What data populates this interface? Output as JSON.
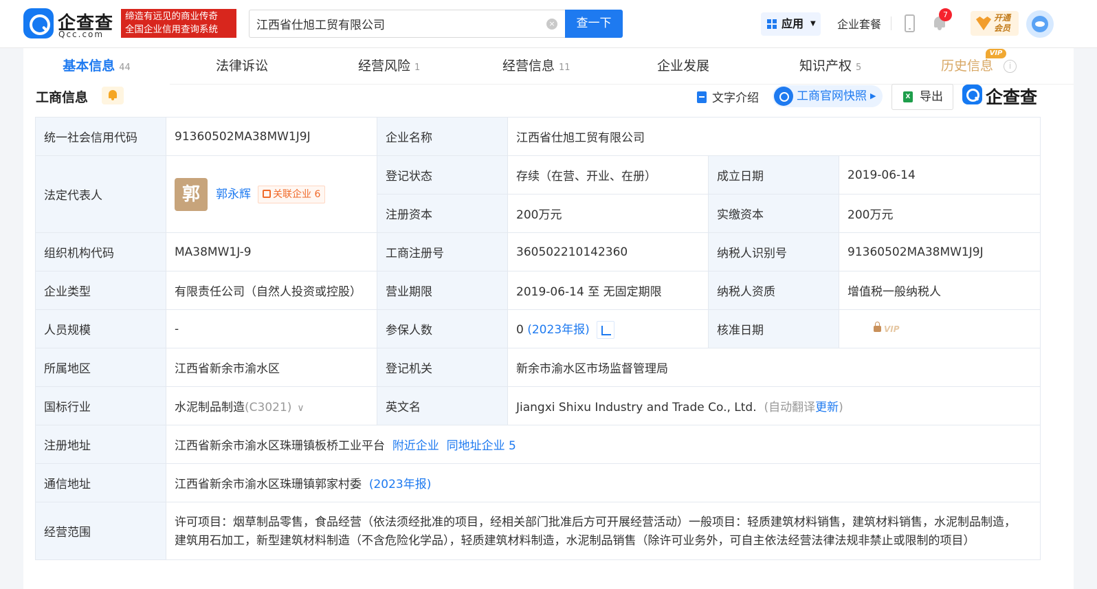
{
  "header": {
    "logo_cn": "企查查",
    "logo_en": "Qcc.com",
    "slogan_line1": "缔造有远见的商业传奇",
    "slogan_line2": "全国企业信用查询系统",
    "search_value": "江西省仕旭工贸有限公司",
    "search_button": "查一下",
    "app_label": "应用",
    "package_label": "企业套餐",
    "notification_count": "7",
    "vip_line1": "开通",
    "vip_line2": "会员"
  },
  "tabs": [
    {
      "label": "基本信息",
      "count": "44"
    },
    {
      "label": "法律诉讼",
      "count": ""
    },
    {
      "label": "经营风险",
      "count": "1"
    },
    {
      "label": "经营信息",
      "count": "11"
    },
    {
      "label": "企业发展",
      "count": ""
    },
    {
      "label": "知识产权",
      "count": "5"
    },
    {
      "label": "历史信息",
      "count": "",
      "tag": "VIP"
    }
  ],
  "section": {
    "title": "工商信息",
    "text_intro": "文字介绍",
    "official_snapshot": "工商官网快照",
    "export": "导出",
    "brand": "企查查"
  },
  "info": {
    "credit_code_label": "统一社会信用代码",
    "credit_code": "91360502MA38MW1J9J",
    "company_name_label": "企业名称",
    "company_name": "江西省仕旭工贸有限公司",
    "legal_rep_label": "法定代表人",
    "legal_rep_avatar": "郭",
    "legal_rep_name": "郭永辉",
    "legal_rep_related": "关联企业 6",
    "reg_status_label": "登记状态",
    "reg_status": "存续（在营、开业、在册）",
    "found_date_label": "成立日期",
    "found_date": "2019-06-14",
    "reg_capital_label": "注册资本",
    "reg_capital": "200万元",
    "paid_capital_label": "实缴资本",
    "paid_capital": "200万元",
    "org_code_label": "组织机构代码",
    "org_code": "MA38MW1J-9",
    "reg_no_label": "工商注册号",
    "reg_no": "360502210142360",
    "taxpayer_id_label": "纳税人识别号",
    "taxpayer_id": "91360502MA38MW1J9J",
    "company_type_label": "企业类型",
    "company_type": "有限责任公司（自然人投资或控股）",
    "term_label": "营业期限",
    "term": "2019-06-14 至 无固定期限",
    "taxpayer_qual_label": "纳税人资质",
    "taxpayer_qual": "增值税一般纳税人",
    "staff_size_label": "人员规模",
    "staff_size": "-",
    "insured_label": "参保人数",
    "insured": "0",
    "insured_year": "(2023年报)",
    "approval_date_label": "核准日期",
    "approval_vip": "VIP",
    "region_label": "所属地区",
    "region": "江西省新余市渝水区",
    "authority_label": "登记机关",
    "authority": "新余市渝水区市场监督管理局",
    "industry_label": "国标行业",
    "industry": "水泥制品制造",
    "industry_code": "(C3021)",
    "english_name_label": "英文名",
    "english_name": "Jiangxi Shixu Industry and Trade Co., Ltd.",
    "auto_translate": "(自动翻译",
    "update_link": "更新",
    "close_paren": ")",
    "reg_address_label": "注册地址",
    "reg_address": "江西省新余市渝水区珠珊镇板桥工业平台",
    "nearby": "附近企业",
    "same_address": "同地址企业 5",
    "mail_address_label": "通信地址",
    "mail_address": "江西省新余市渝水区珠珊镇郭家村委",
    "mail_year": "(2023年报)",
    "scope_label": "经营范围",
    "scope_line1": "许可项目：烟草制品零售，食品经营（依法须经批准的项目，经相关部门批准后方可开展经营活动）一般项目：轻质建筑材料销售，建筑材料销售，水泥制品制造，",
    "scope_line2": "建筑用石加工，新型建筑材料制造（不含危险化学品），轻质建筑材料制造，水泥制品销售（除许可业务外，可自主依法经营法律法规非禁止或限制的项目）"
  }
}
